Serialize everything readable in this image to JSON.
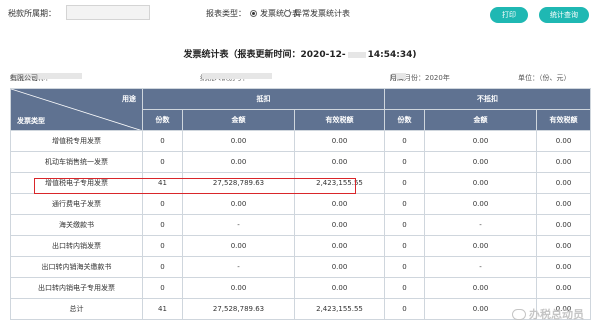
{
  "toolbar": {
    "period_label": "税款所属期：",
    "period_value": "",
    "report_type_label": "报表类型：",
    "radio_invoice": "发票统计表",
    "radio_abnormal": "异常发票统计表",
    "print_button": "打印",
    "query_button": "统计查询"
  },
  "report": {
    "title": "发票统计表（报表更新时间：2020-12-",
    "title_tail": "14:54:34)",
    "taxpayer_name_label": "纳税人名称：",
    "taxpayer_name_tail": "有限公司",
    "taxpayer_id_label": "纳税人识别号：",
    "period_label": "所属月份：2020年",
    "period_tail": "月",
    "unit_label": "单位：（份、元）"
  },
  "table": {
    "diag_top": "用途",
    "diag_bottom": "发票类型",
    "group_deduct": "抵扣",
    "group_nondeduct": "不抵扣",
    "sub_headers": [
      "份数",
      "金额",
      "有效税额",
      "份数",
      "金额",
      "有效税额"
    ],
    "rows": [
      {
        "name": "增值税专用发票",
        "c1": "0",
        "c2": "0.00",
        "c3": "0.00",
        "c4": "0",
        "c5": "0.00",
        "c6": "0.00"
      },
      {
        "name": "机动车销售统一发票",
        "c1": "0",
        "c2": "0.00",
        "c3": "0.00",
        "c4": "0",
        "c5": "0.00",
        "c6": "0.00"
      },
      {
        "name": "增值税电子专用发票",
        "c1": "41",
        "c2": "27,528,789.63",
        "c3": "2,423,155.55",
        "c4": "0",
        "c5": "0.00",
        "c6": "0.00"
      },
      {
        "name": "通行费电子发票",
        "c1": "0",
        "c2": "0.00",
        "c3": "0.00",
        "c4": "0",
        "c5": "0.00",
        "c6": "0.00"
      },
      {
        "name": "海关缴款书",
        "c1": "0",
        "c2": "-",
        "c3": "0.00",
        "c4": "0",
        "c5": "-",
        "c6": "0.00"
      },
      {
        "name": "出口转内销发票",
        "c1": "0",
        "c2": "0.00",
        "c3": "0.00",
        "c4": "0",
        "c5": "0.00",
        "c6": "0.00"
      },
      {
        "name": "出口转内销海关缴款书",
        "c1": "0",
        "c2": "-",
        "c3": "0.00",
        "c4": "0",
        "c5": "-",
        "c6": "0.00"
      },
      {
        "name": "出口转内销电子专用发票",
        "c1": "0",
        "c2": "0.00",
        "c3": "0.00",
        "c4": "0",
        "c5": "0.00",
        "c6": "0.00"
      },
      {
        "name": "总计",
        "c1": "41",
        "c2": "27,528,789.63",
        "c3": "2,423,155.55",
        "c4": "0",
        "c5": "0.00",
        "c6": "0.00"
      }
    ]
  },
  "watermark": "办税总动员",
  "colors": {
    "header_bg": "#5f7291",
    "button_bg": "#1fb8b3",
    "highlight": "#d9262a"
  }
}
